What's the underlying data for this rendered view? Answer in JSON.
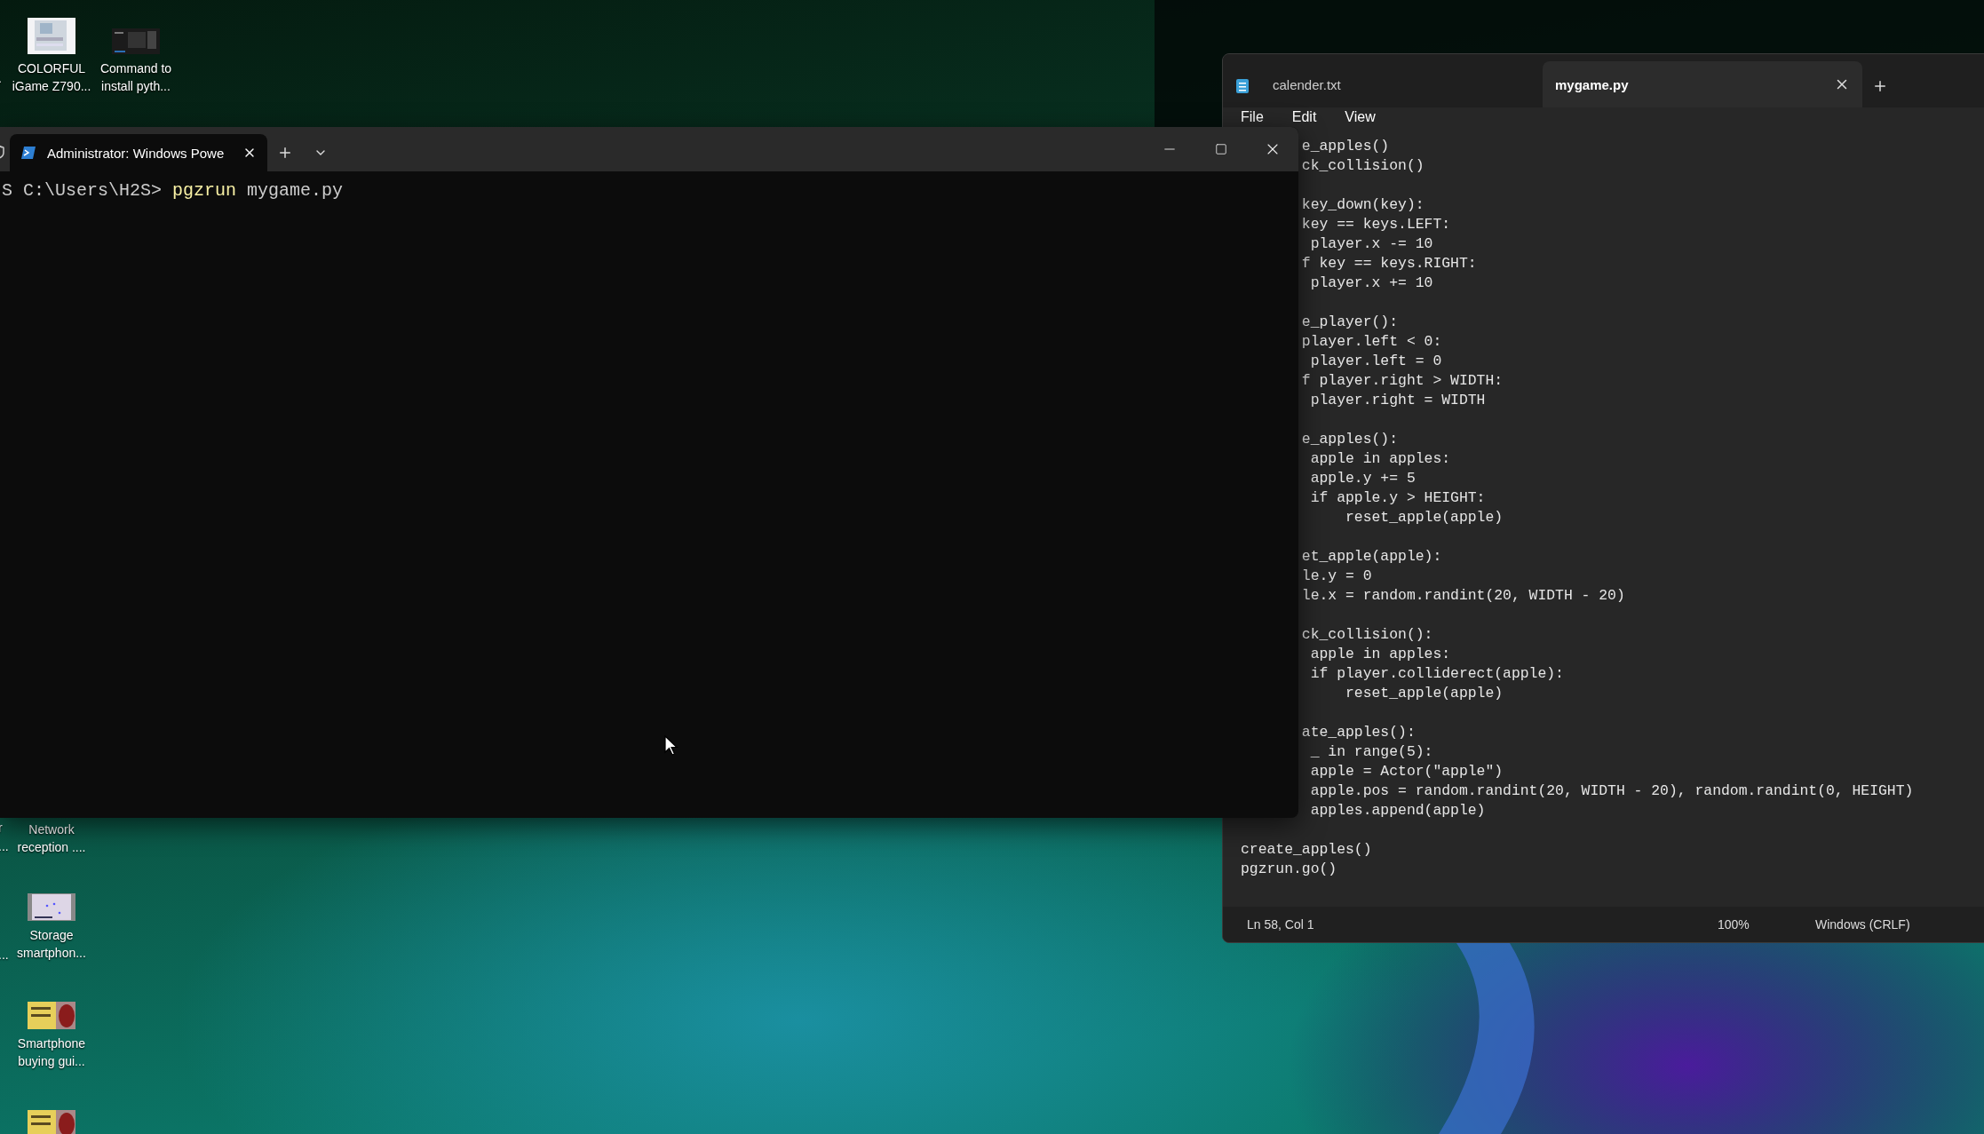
{
  "desktop": {
    "icons": [
      {
        "kind": "board",
        "label_lines": [
          "COLORFUL",
          "iGame Z790..."
        ]
      },
      {
        "kind": "screenshot",
        "label_lines": [
          "Command to",
          "install pyth..."
        ]
      },
      {
        "kind": "hidden",
        "label_lines": [
          "Network",
          "reception ...."
        ]
      },
      {
        "kind": "chart",
        "label_lines": [
          "Storage",
          "smartphon..."
        ]
      },
      {
        "kind": "poster",
        "label_lines": [
          "Smartphone",
          "buying gui..."
        ]
      },
      {
        "kind": "poster"
      }
    ],
    "partial_labels": [
      ".",
      "r",
      "...",
      "..."
    ]
  },
  "notepad": {
    "tabs": [
      {
        "label": "calender.txt",
        "selected": false
      },
      {
        "label": "mygame.py",
        "selected": true
      }
    ],
    "menu": [
      "File",
      "Edit",
      "View"
    ],
    "clipped_code": "e_apples()\nck_collision()\n\nkey_down(key):\nkey == keys.LEFT:\n player.x -= 10\nf key == keys.RIGHT:\n player.x += 10\n\ne_player():\nplayer.left < 0:\n player.left = 0\nf player.right > WIDTH:\n player.right = WIDTH\n\ne_apples():\n apple in apples:\n apple.y += 5\n if apple.y > HEIGHT:\n     reset_apple(apple)\n\net_apple(apple):\nle.y = 0\nle.x = random.randint(20, WIDTH - 20)\n\nck_collision():\n apple in apples:\n if player.colliderect(apple):\n     reset_apple(apple)\n\nate_apples():\n _ in range(5):\n apple = Actor(\"apple\")\n apple.pos = random.randint(20, WIDTH - 20), random.randint(0, HEIGHT)\n apples.append(apple)",
    "code": "create_apples()\npgzrun.go()",
    "status": {
      "position": "Ln 58, Col 1",
      "zoom": "100%",
      "line_ending": "Windows (CRLF)"
    }
  },
  "terminal": {
    "tab_title": "Administrator: Windows Powe",
    "prompt": "S C:\\Users\\H2S> ",
    "command": "pgzrun",
    "args": " mygame.py"
  }
}
